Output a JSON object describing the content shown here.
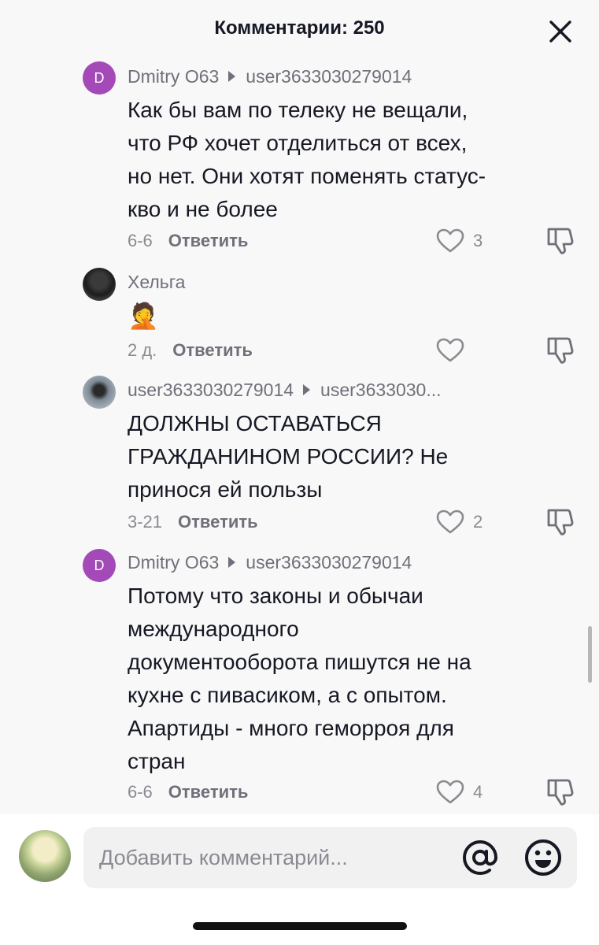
{
  "header": {
    "title": "Комментарии: 250"
  },
  "comments": [
    {
      "avatar_letter": "D",
      "author": "Dmitry O63",
      "reply_to": "user3633030279014",
      "text_lines": [
        "Как бы вам по телеку не вещали,",
        "что РФ хочет отделиться от всех,",
        "но нет. Они хотят поменять статус-",
        "кво и не более"
      ],
      "date": "6-6",
      "reply_label": "Ответить",
      "likes": "3"
    },
    {
      "avatar_letter": "",
      "author": "Хельга",
      "emoji": "🤦",
      "date": "2 д.",
      "reply_label": "Ответить",
      "likes": ""
    },
    {
      "author": "user3633030279014",
      "reply_to": "user3633030...",
      "text_lines": [
        "ДОЛЖНЫ ОСТАВАТЬСЯ",
        "ГРАЖДАНИНОМ РОССИИ? Не",
        "принося ей пользы"
      ],
      "date": "3-21",
      "reply_label": "Ответить",
      "likes": "2"
    },
    {
      "avatar_letter": "D",
      "author": "Dmitry O63",
      "reply_to": "user3633030279014",
      "text_lines": [
        "Потому что законы и обычаи",
        "международного",
        "документооборота пишутся не на",
        "кухне с пивасиком, а с опытом.",
        "Апартиды - много геморроя для",
        "стран"
      ],
      "date": "6-6",
      "reply_label": "Ответить",
      "likes": "4"
    }
  ],
  "composer": {
    "placeholder": "Добавить комментарий..."
  },
  "colors": {
    "text": "#161823",
    "muted": "#8a8b91",
    "avatar_purple": "#a349b8",
    "sheet_bg": "#f8f8f8"
  },
  "icons": [
    "close-icon",
    "reply-arrow-icon",
    "heart-icon",
    "dislike-icon",
    "at-icon",
    "emoji-icon"
  ]
}
